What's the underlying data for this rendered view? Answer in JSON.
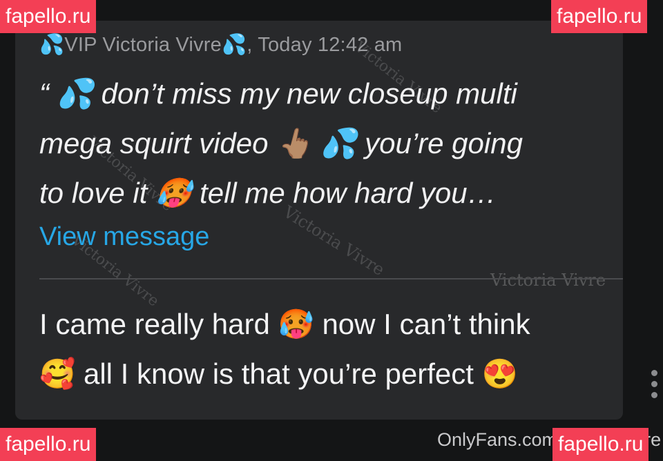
{
  "quoted_message": {
    "header": "💦VIP Victoria Vivre💦, Today 12:42 am",
    "body": "“ 💦 don’t miss my new closeup multi\nmega squirt video 👆🏽 💦 you’re going\nto love it 🥵 tell me how hard you…",
    "link_label": "View message"
  },
  "reply": {
    "body": "I came really hard 🥵 now I can’t think\n🥰 all I know is that you’re perfect 😍"
  },
  "watermarks": [
    "Victoria Vivre",
    "Victoria Vivre",
    "Victoria Vivre",
    "Victoria Vivre",
    "Victoria Vivre"
  ],
  "badges": [
    "fapello.ru",
    "fapello.ru",
    "fapello.ru",
    "fapello.ru"
  ],
  "footer": {
    "source": "OnlyFans.com/victoriavivre"
  },
  "colors": {
    "background": "#141516",
    "card": "#28292b",
    "link": "#27a7e6",
    "badge": "#f33f55"
  },
  "icons": {
    "menu": "more-vertical-icon"
  }
}
